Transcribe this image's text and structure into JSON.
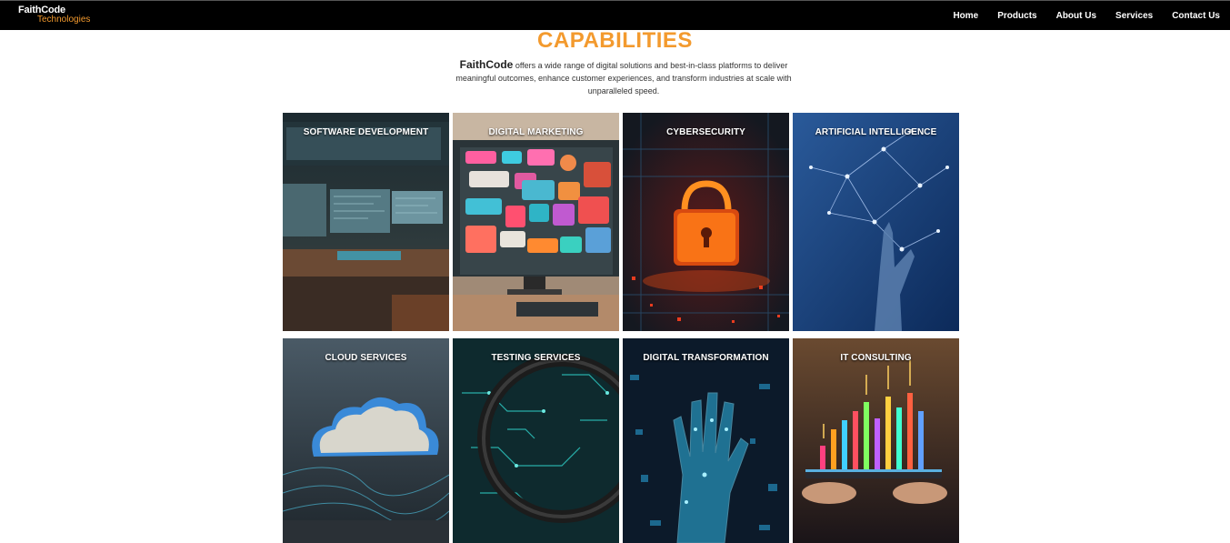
{
  "nav": {
    "logo_top": "FaithCode",
    "logo_bottom": "Technologies",
    "items": [
      "Home",
      "Products",
      "About Us",
      "Services",
      "Contact Us"
    ]
  },
  "section": {
    "title": "CAPABILITIES",
    "brand": "FaithCode",
    "description_line1": " offers a wide range of digital solutions and best-in-class platforms to deliver",
    "description_line2": "meaningful outcomes, enhance customer experiences, and transform industries at scale with",
    "description_line3": "unparalleled speed."
  },
  "cards": [
    {
      "label": "SOFTWARE DEVELOPMENT",
      "image": "developer-workstation-image"
    },
    {
      "label": "DIGITAL MARKETING",
      "image": "marketing-screen-image"
    },
    {
      "label": "CYBERSECURITY",
      "image": "padlock-circuit-image"
    },
    {
      "label": "ARTIFICIAL INTELLIGENCE",
      "image": "robot-hand-network-image"
    },
    {
      "label": "CLOUD SERVICES",
      "image": "cloud-circuit-image"
    },
    {
      "label": "TESTING SERVICES",
      "image": "magnifier-circuit-image"
    },
    {
      "label": "DIGITAL TRANSFORMATION",
      "image": "digital-hand-image"
    },
    {
      "label": "IT CONSULTING",
      "image": "tablet-growth-chart-image"
    }
  ],
  "colors": {
    "accent": "#f39a2e",
    "nav_bg": "#000000"
  }
}
